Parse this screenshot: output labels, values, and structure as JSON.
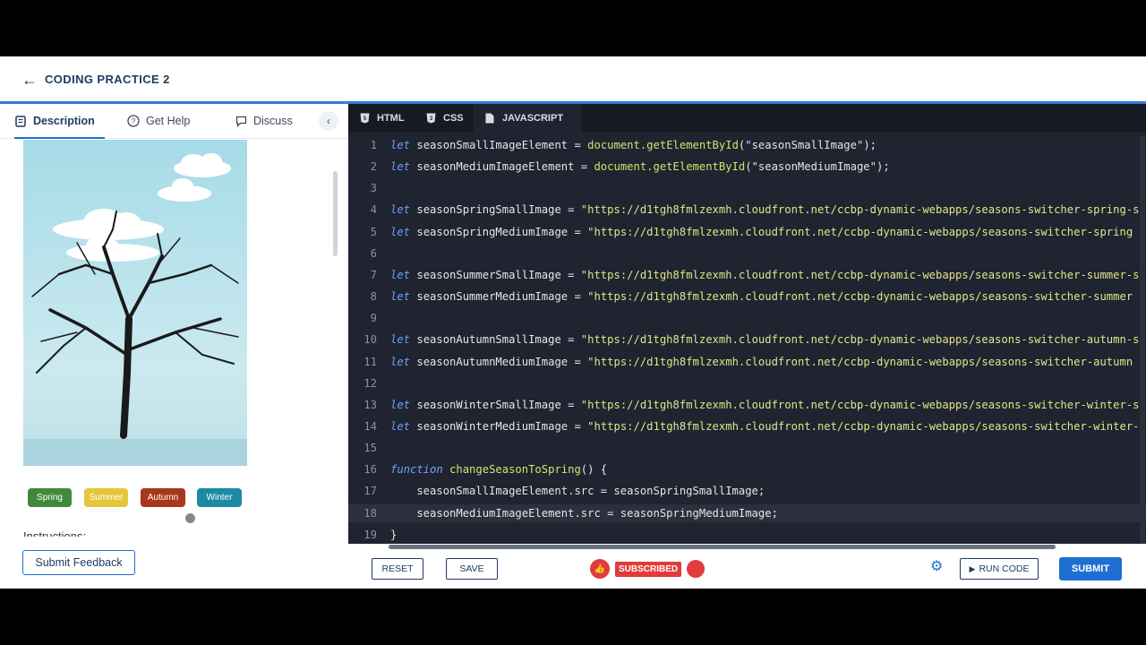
{
  "header": {
    "title": "CODING PRACTICE 2"
  },
  "left_tabs": [
    {
      "label": "Description"
    },
    {
      "label": "Get Help"
    },
    {
      "label": "Discuss"
    }
  ],
  "season_buttons": [
    {
      "label": "Spring",
      "color": "#3f8a3a"
    },
    {
      "label": "Summer",
      "color": "#e3c63a"
    },
    {
      "label": "Autumn",
      "color": "#a8371c"
    },
    {
      "label": "Winter",
      "color": "#1c8aa3"
    }
  ],
  "instructions_heading": "Instructions:",
  "feedback_button": "Submit Feedback",
  "editor_tabs": [
    {
      "label": "HTML"
    },
    {
      "label": "CSS"
    },
    {
      "label": "JAVASCRIPT"
    }
  ],
  "code_lines": [
    {
      "num": "1",
      "kw": "let",
      "rest": " seasonSmallImageElement = ",
      "fn": "document.getElementById",
      "tail": "(\"seasonSmallImage\");"
    },
    {
      "num": "2",
      "kw": "let",
      "rest": " seasonMediumImageElement = ",
      "fn": "document.getElementById",
      "tail": "(\"seasonMediumImage\");"
    },
    {
      "num": "3",
      "kw": "",
      "rest": "",
      "fn": "",
      "tail": ""
    },
    {
      "num": "4",
      "kw": "let",
      "rest": " seasonSpringSmallImage = ",
      "fn": "",
      "tail": "\"https://d1tgh8fmlzexmh.cloudfront.net/ccbp-dynamic-webapps/seasons-switcher-spring-s"
    },
    {
      "num": "5",
      "kw": "let",
      "rest": " seasonSpringMediumImage = ",
      "fn": "",
      "tail": "\"https://d1tgh8fmlzexmh.cloudfront.net/ccbp-dynamic-webapps/seasons-switcher-spring"
    },
    {
      "num": "6",
      "kw": "",
      "rest": "",
      "fn": "",
      "tail": ""
    },
    {
      "num": "7",
      "kw": "let",
      "rest": " seasonSummerSmallImage = ",
      "fn": "",
      "tail": "\"https://d1tgh8fmlzexmh.cloudfront.net/ccbp-dynamic-webapps/seasons-switcher-summer-s"
    },
    {
      "num": "8",
      "kw": "let",
      "rest": " seasonSummerMediumImage = ",
      "fn": "",
      "tail": "\"https://d1tgh8fmlzexmh.cloudfront.net/ccbp-dynamic-webapps/seasons-switcher-summer"
    },
    {
      "num": "9",
      "kw": "",
      "rest": "",
      "fn": "",
      "tail": ""
    },
    {
      "num": "10",
      "kw": "let",
      "rest": " seasonAutumnSmallImage = ",
      "fn": "",
      "tail": "\"https://d1tgh8fmlzexmh.cloudfront.net/ccbp-dynamic-webapps/seasons-switcher-autumn-s"
    },
    {
      "num": "11",
      "kw": "let",
      "rest": " seasonAutumnMediumImage = ",
      "fn": "",
      "tail": "\"https://d1tgh8fmlzexmh.cloudfront.net/ccbp-dynamic-webapps/seasons-switcher-autumn"
    },
    {
      "num": "12",
      "kw": "",
      "rest": "",
      "fn": "",
      "tail": ""
    },
    {
      "num": "13",
      "kw": "let",
      "rest": " seasonWinterSmallImage = ",
      "fn": "",
      "tail": "\"https://d1tgh8fmlzexmh.cloudfront.net/ccbp-dynamic-webapps/seasons-switcher-winter-s"
    },
    {
      "num": "14",
      "kw": "let",
      "rest": " seasonWinterMediumImage = ",
      "fn": "",
      "tail": "\"https://d1tgh8fmlzexmh.cloudfront.net/ccbp-dynamic-webapps/seasons-switcher-winter-"
    },
    {
      "num": "15",
      "kw": "",
      "rest": "",
      "fn": "",
      "tail": ""
    },
    {
      "num": "16",
      "kw": "function",
      "rest": " ",
      "fn": "changeSeasonToSpring",
      "tail": "() {"
    },
    {
      "num": "17",
      "kw": "",
      "rest": "    seasonSmallImageElement.src = seasonSpringSmallImage;",
      "fn": "",
      "tail": ""
    },
    {
      "num": "18",
      "kw": "",
      "rest": "    seasonMediumImageElement.src = seasonSpringMediumImage;",
      "fn": "",
      "tail": ""
    },
    {
      "num": "19",
      "kw": "",
      "rest": "}",
      "fn": "",
      "tail": ""
    }
  ],
  "bottom": {
    "reset": "RESET",
    "save": "SAVE",
    "subscribed": "SUBSCRIBED",
    "run_code": "RUN CODE",
    "submit": "SUBMIT"
  }
}
